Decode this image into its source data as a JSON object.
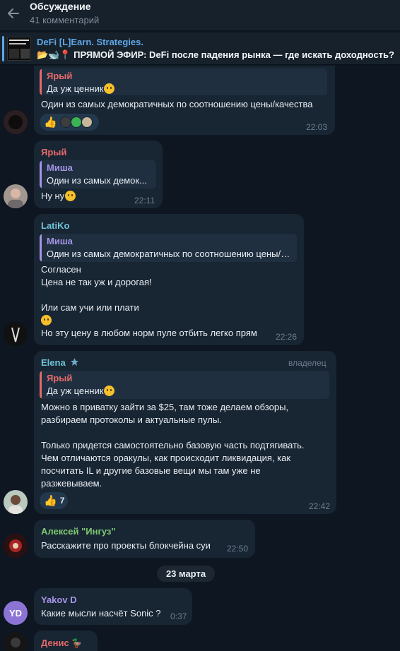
{
  "header": {
    "title": "Обсуждение",
    "subtitle": "41 комментарий"
  },
  "pinned": {
    "channel": "DeFi [L]Earn. Strategies.",
    "text": "📂🐋📍 ПРЯМОЙ ЭФИР: DeFi после падения рынка — где искать доходность?",
    "thumb_lines": [
      "АПТОВ И ЛЕТ НЕ",
      "ЩЕЕ РЫНКА"
    ]
  },
  "colors": {
    "background": "#0e1621",
    "bubble": "#182533",
    "accent": "#5ea7e8",
    "name_red": "#e86a6a",
    "name_cyan": "#6fc3d6",
    "name_green": "#7ecb72",
    "name_purple": "#a695e7"
  },
  "messages": [
    {
      "reply_name": "Ярый",
      "reply_text": "Да уж ценник",
      "lines": [
        "Один из самых демократичных по соотношению цены/качества"
      ],
      "time": "22:03",
      "reactions": "👍"
    },
    {
      "sender": "Ярый",
      "reply_name": "Миша",
      "reply_text": "Один из самых демок...",
      "lines": [
        "Ну ну"
      ],
      "time": "22:11"
    },
    {
      "sender": "LatiKo",
      "reply_name": "Миша",
      "reply_text": "Один из самых демократичных по соотношению цены/качества",
      "lines": [
        "Согласен",
        "Цена не так уж и дорогая!",
        "",
        "Или сам учи или плати",
        "",
        "Но эту цену в любом норм пуле отбить легко прям"
      ],
      "time": "22:26"
    },
    {
      "sender": "Elena",
      "badge": "владелец",
      "reply_name": "Ярый",
      "reply_text": "Да уж ценник",
      "lines": [
        "Можно в приватку зайти за $25, там тоже делаем обзоры,",
        "разбираем протоколы и актуальные пулы.",
        "",
        "Только придется самостоятельно базовую часть подтягивать.",
        "Чем отличаются оракулы, как происходит ликвидация, как",
        "посчитать IL и другие базовые вещи мы там уже не",
        "разжевываем."
      ],
      "time": "22:42",
      "reaction_icon": "👍",
      "reaction_count": "7"
    },
    {
      "sender": "Алексей \"Ингуз\"",
      "lines": [
        "Расскажите про проекты блокчейна суи"
      ],
      "time": "22:50"
    },
    {
      "sender": "Yakov D",
      "avatar_initials": "YD",
      "lines": [
        "Какие мысли насчёт Sonic ?"
      ],
      "time": "0:37"
    },
    {
      "sender": "Денис"
    }
  ],
  "date_separator": "23 марта",
  "icons": {
    "back": "back-arrow-icon",
    "star": "star-icon",
    "thumbs_up": "thumbs-up-icon"
  }
}
